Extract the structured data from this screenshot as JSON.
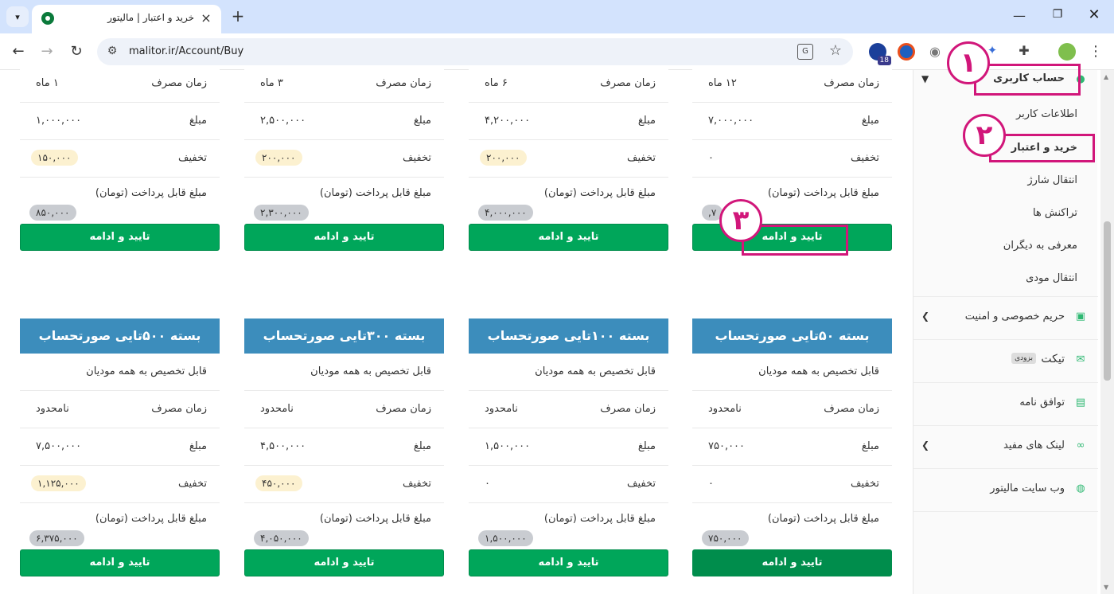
{
  "browser": {
    "tab_title": "خرید و اعتبار | مالیتور",
    "url": "malitor.ir/Account/Buy",
    "new_tab": "+",
    "ext_badge": "18"
  },
  "cards_top": [
    {
      "time_label": "زمان مصرف",
      "time_value": "۱۲ ماه",
      "price_label": "مبلغ",
      "price_value": "۷,۰۰۰,۰۰۰",
      "discount_label": "تخفیف",
      "discount_value": "۰",
      "discount_pill": false,
      "payable_label": "مبلغ قابل پرداخت (تومان)",
      "payable_value": "۷,",
      "button": "تایید و ادامه"
    },
    {
      "time_label": "زمان مصرف",
      "time_value": "۶ ماه",
      "price_label": "مبلغ",
      "price_value": "۴,۲۰۰,۰۰۰",
      "discount_label": "تخفیف",
      "discount_value": "۲۰۰,۰۰۰",
      "discount_pill": true,
      "payable_label": "مبلغ قابل پرداخت (تومان)",
      "payable_value": "۴,۰۰۰,۰۰۰",
      "button": "تایید و ادامه"
    },
    {
      "time_label": "زمان مصرف",
      "time_value": "۳ ماه",
      "price_label": "مبلغ",
      "price_value": "۲,۵۰۰,۰۰۰",
      "discount_label": "تخفیف",
      "discount_value": "۲۰۰,۰۰۰",
      "discount_pill": true,
      "payable_label": "مبلغ قابل پرداخت (تومان)",
      "payable_value": "۲,۳۰۰,۰۰۰",
      "button": "تایید و ادامه"
    },
    {
      "time_label": "زمان مصرف",
      "time_value": "۱ ماه",
      "price_label": "مبلغ",
      "price_value": "۱,۰۰۰,۰۰۰",
      "discount_label": "تخفیف",
      "discount_value": "۱۵۰,۰۰۰",
      "discount_pill": true,
      "payable_label": "مبلغ قابل پرداخت (تومان)",
      "payable_value": "۸۵۰,۰۰۰",
      "button": "تایید و ادامه"
    }
  ],
  "cards_bottom": [
    {
      "title": "بسته ۵۰تایی صورتحساب",
      "assign": "قابل تخصیص به همه مودیان",
      "time_label": "زمان مصرف",
      "time_value": "نامحدود",
      "price_label": "مبلغ",
      "price_value": "۷۵۰,۰۰۰",
      "discount_label": "تخفیف",
      "discount_value": "۰",
      "discount_pill": false,
      "payable_label": "مبلغ قابل پرداخت (تومان)",
      "payable_value": "۷۵۰,۰۰۰",
      "button": "تایید و ادامه"
    },
    {
      "title": "بسته ۱۰۰تایی صورتحساب",
      "assign": "قابل تخصیص به همه مودیان",
      "time_label": "زمان مصرف",
      "time_value": "نامحدود",
      "price_label": "مبلغ",
      "price_value": "۱,۵۰۰,۰۰۰",
      "discount_label": "تخفیف",
      "discount_value": "۰",
      "discount_pill": false,
      "payable_label": "مبلغ قابل پرداخت (تومان)",
      "payable_value": "۱,۵۰۰,۰۰۰",
      "button": "تایید و ادامه"
    },
    {
      "title": "بسته ۳۰۰تایی صورتحساب",
      "assign": "قابل تخصیص به همه مودیان",
      "time_label": "زمان مصرف",
      "time_value": "نامحدود",
      "price_label": "مبلغ",
      "price_value": "۴,۵۰۰,۰۰۰",
      "discount_label": "تخفیف",
      "discount_value": "۴۵۰,۰۰۰",
      "discount_pill": true,
      "payable_label": "مبلغ قابل پرداخت (تومان)",
      "payable_value": "۴,۰۵۰,۰۰۰",
      "button": "تایید و ادامه"
    },
    {
      "title": "بسته ۵۰۰تایی صورتحساب",
      "assign": "قابل تخصیص به همه مودیان",
      "time_label": "زمان مصرف",
      "time_value": "نامحدود",
      "price_label": "مبلغ",
      "price_value": "۷,۵۰۰,۰۰۰",
      "discount_label": "تخفیف",
      "discount_value": "۱,۱۲۵,۰۰۰",
      "discount_pill": true,
      "payable_label": "مبلغ قابل پرداخت (تومان)",
      "payable_value": "۶,۳۷۵,۰۰۰",
      "button": "تایید و ادامه"
    }
  ],
  "sidebar": {
    "account": "حساب کاربری",
    "sub_items": [
      "اطلاعات کاربر",
      "خرید و اعتبار",
      "انتقال شارژ",
      "تراکنش ها",
      "معرفی به دیگران",
      "انتقال مودی"
    ],
    "privacy": "حریم خصوصی و امنیت",
    "ticket": "تیکت",
    "ticket_badge": "بزودی",
    "agreement": "توافق نامه",
    "links": "لینک های مفید",
    "website": "وب سایت مالیتور"
  },
  "annotations": [
    "۱",
    "۲",
    "۳"
  ],
  "colors": {
    "header_blue": "#3c8dbc",
    "button_green": "#00a65a",
    "highlight": "#d1167a",
    "sidebar_icon": "#2eb872"
  }
}
